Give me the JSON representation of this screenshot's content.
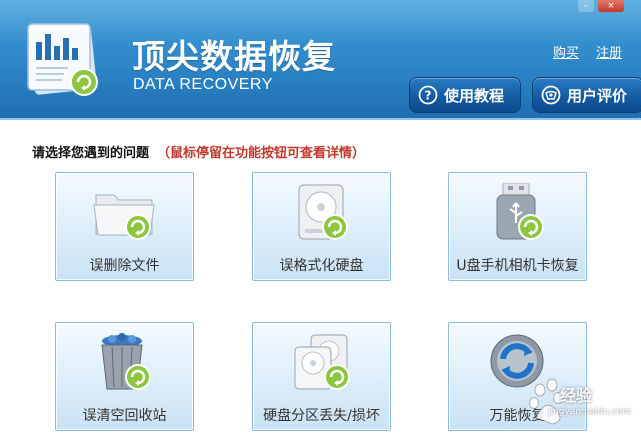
{
  "header": {
    "title": "顶尖数据恢复",
    "subtitle": "DATA RECOVERY",
    "links": {
      "buy": "购买",
      "register": "注册"
    },
    "buttons": {
      "tutorial": {
        "label": "使用教程",
        "icon": "question-circle-icon"
      },
      "review": {
        "label": "用户评价",
        "icon": "review-icon"
      }
    }
  },
  "prompt": {
    "main": "请选择您遇到的问题",
    "hint": "（鼠标停留在功能按钮可查看详情）"
  },
  "tiles": [
    {
      "label": "误删除文件",
      "icon": "folder-restore-icon"
    },
    {
      "label": "误格式化硬盘",
      "icon": "hard-drive-icon"
    },
    {
      "label": "U盘手机相机卡恢复",
      "icon": "usb-drive-icon"
    },
    {
      "label": "误清空回收站",
      "icon": "recycle-bin-icon"
    },
    {
      "label": "硬盘分区丢失/损坏",
      "icon": "partition-drives-icon"
    },
    {
      "label": "万能恢复",
      "icon": "universal-restore-icon"
    }
  ],
  "watermark": {
    "text": "经验",
    "url": "jingyan.baidu.com"
  },
  "colors": {
    "header_top": "#3f9ed9",
    "header_bottom": "#1f6fb1",
    "button_dark": "#12599f",
    "hint_red": "#c0392b",
    "tile_border": "#8fb9d8",
    "restore_green": "#8cc63f"
  }
}
